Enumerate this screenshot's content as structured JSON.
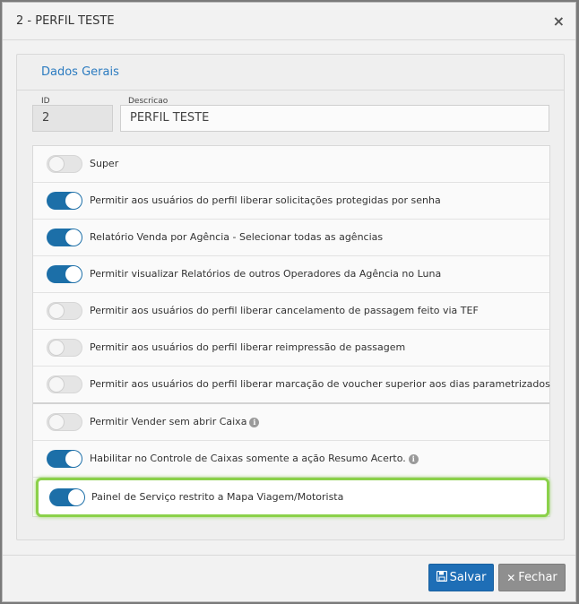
{
  "modal": {
    "title": "2 - PERFIL TESTE",
    "close_glyph": "×"
  },
  "panel": {
    "title": "Dados Gerais"
  },
  "fields": {
    "id": {
      "label": "ID",
      "value": "2"
    },
    "descricao": {
      "label": "Descricao",
      "value": "PERFIL TESTE"
    }
  },
  "permissions": [
    {
      "label": "Super",
      "enabled": false
    },
    {
      "label": "Permitir aos usuários do perfil liberar solicitações protegidas por senha",
      "enabled": true
    },
    {
      "label": "Relatório Venda por Agência - Selecionar todas as agências",
      "enabled": true
    },
    {
      "label": "Permitir visualizar Relatórios de outros Operadores da Agência no Luna",
      "enabled": true
    },
    {
      "label": "Permitir aos usuários do perfil liberar cancelamento de passagem feito via TEF",
      "enabled": false
    },
    {
      "label": "Permitir aos usuários do perfil liberar reimpressão de passagem",
      "enabled": false
    },
    {
      "label": "Permitir aos usuários do perfil liberar marcação de voucher superior aos dias parametrizados",
      "enabled": false
    },
    {
      "label": "Permitir Vender sem abrir Caixa",
      "enabled": false,
      "info": true
    },
    {
      "label": "Habilitar no Controle de Caixas somente a ação Resumo Acerto.",
      "enabled": true,
      "info": true
    },
    {
      "label": "Painel de Serviço restrito a Mapa Viagem/Motorista",
      "enabled": true,
      "highlighted": true
    }
  ],
  "buttons": {
    "save": "Salvar",
    "close": "Fechar"
  },
  "icons": {
    "save": "floppy-disk-icon",
    "close": "times-icon",
    "info": "info-circle-icon"
  },
  "colors": {
    "accent": "#1e6eb6",
    "toggle_on": "#1c6fa8",
    "highlight_border": "#8bd14a",
    "close_button": "#8f8f8f"
  }
}
